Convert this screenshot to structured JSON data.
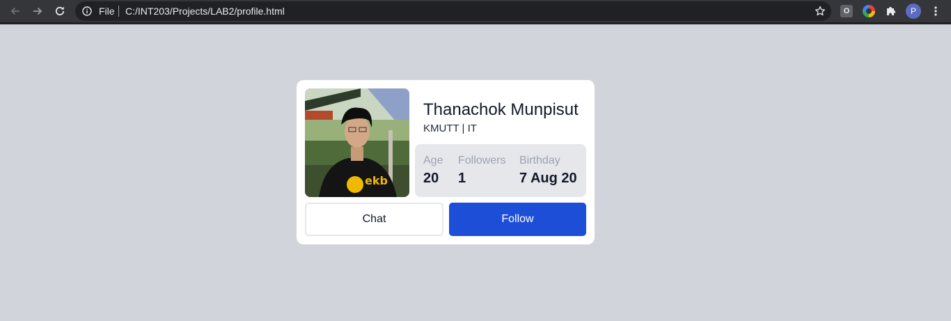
{
  "browser": {
    "scheme_label": "File",
    "url": "C:/INT203/Projects/LAB2/profile.html",
    "extension_o_label": "O",
    "profile_initial": "P"
  },
  "profile": {
    "name": "Thanachok Munpisut",
    "subtitle": "KMUTT | IT",
    "photo_logo_text": "ekb",
    "stats": [
      {
        "label": "Age",
        "value": "20"
      },
      {
        "label": "Followers",
        "value": "1"
      },
      {
        "label": "Birthday",
        "value": "7 Aug 20"
      }
    ],
    "buttons": {
      "chat_label": "Chat",
      "follow_label": "Follow"
    }
  },
  "colors": {
    "page_background": "#d1d5db",
    "card_background": "#ffffff",
    "stats_background": "#e5e7eb",
    "follow_button": "#1d4ed8"
  },
  "icons": [
    "back-arrow-icon",
    "forward-arrow-icon",
    "reload-icon",
    "info-icon",
    "star-icon",
    "puzzle-icon",
    "kebab-menu-icon"
  ]
}
